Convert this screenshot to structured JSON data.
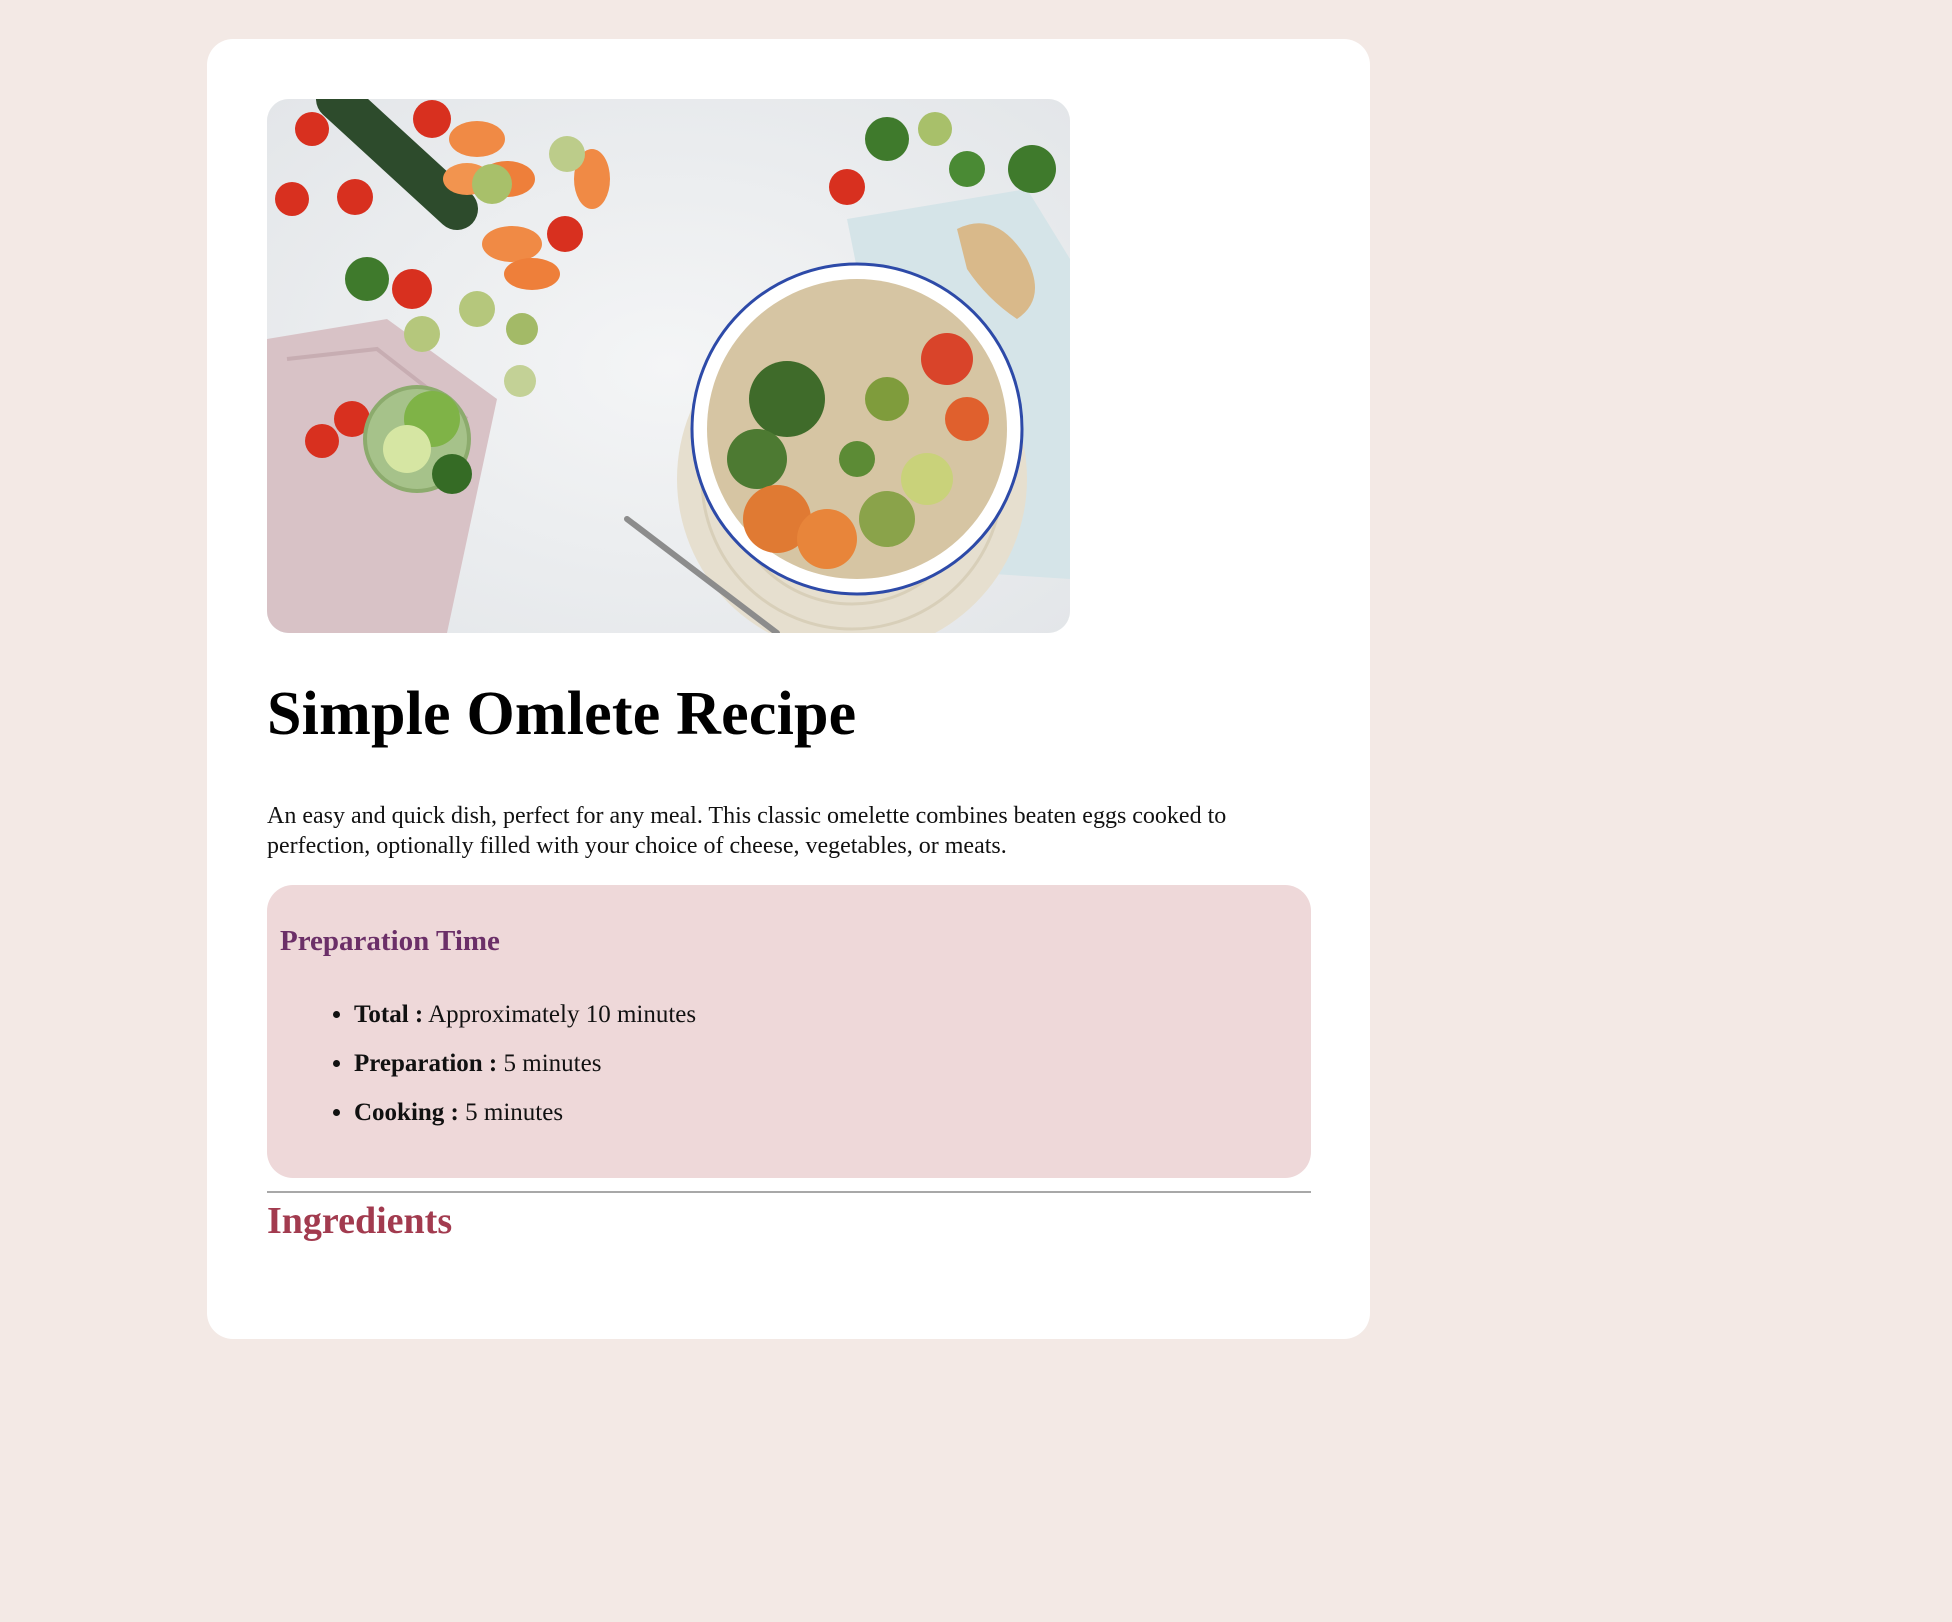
{
  "page": {
    "background": "#f3e9e5",
    "card_background": "#ffffff"
  },
  "hero": {
    "image_description_icon": "food-bowl-photo"
  },
  "recipe": {
    "title": "Simple Omlete Recipe",
    "description": "An easy and quick dish, perfect for any meal. This classic omelette combines beaten eggs cooked to perfection, optionally filled with your choice of cheese, vegetables, or meats."
  },
  "preparation": {
    "heading": "Preparation Time",
    "heading_color": "#6b2f68",
    "box_color": "#eed8d9",
    "items": [
      {
        "label": "Total :",
        "value": " Approximately 10 minutes"
      },
      {
        "label": "Preparation :",
        "value": " 5 minutes"
      },
      {
        "label": "Cooking :",
        "value": " 5 minutes"
      }
    ]
  },
  "ingredients": {
    "heading": "Ingredients",
    "heading_color": "#a23b4f"
  }
}
